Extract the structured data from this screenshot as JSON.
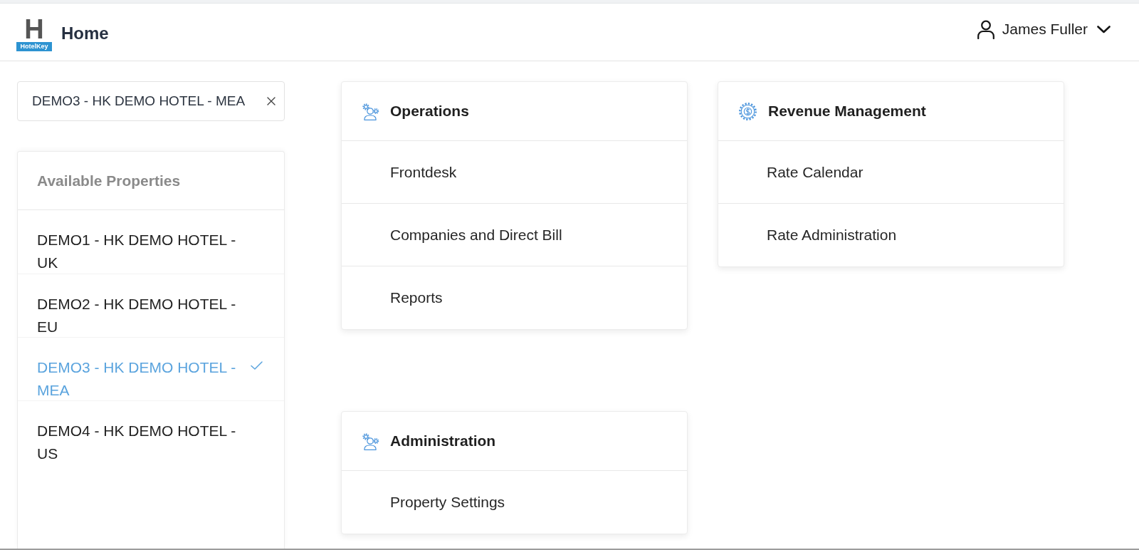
{
  "header": {
    "logo": {
      "letter": "H",
      "caption": "HotelKey"
    },
    "title": "Home",
    "user": {
      "name": "James Fuller"
    }
  },
  "property_select": {
    "value": "DEMO3 - HK DEMO HOTEL - MEA"
  },
  "properties_panel": {
    "title": "Available Properties",
    "items": [
      {
        "label": "DEMO1 - HK DEMO HOTEL - UK",
        "selected": false
      },
      {
        "label": "DEMO2 - HK DEMO HOTEL - EU",
        "selected": false
      },
      {
        "label": "DEMO3 - HK DEMO HOTEL - MEA",
        "selected": true
      },
      {
        "label": "DEMO4 - HK DEMO HOTEL - US",
        "selected": false
      }
    ]
  },
  "cards": [
    {
      "kind": "team",
      "title": "Operations",
      "links": [
        "Frontdesk",
        "Companies and Direct Bill",
        "Reports"
      ]
    },
    {
      "kind": "finance",
      "title": "Revenue Management",
      "links": [
        "Rate Calendar",
        "Rate Administration"
      ]
    },
    {
      "kind": "team",
      "title": "Administration",
      "links": [
        "Property Settings"
      ]
    }
  ]
}
